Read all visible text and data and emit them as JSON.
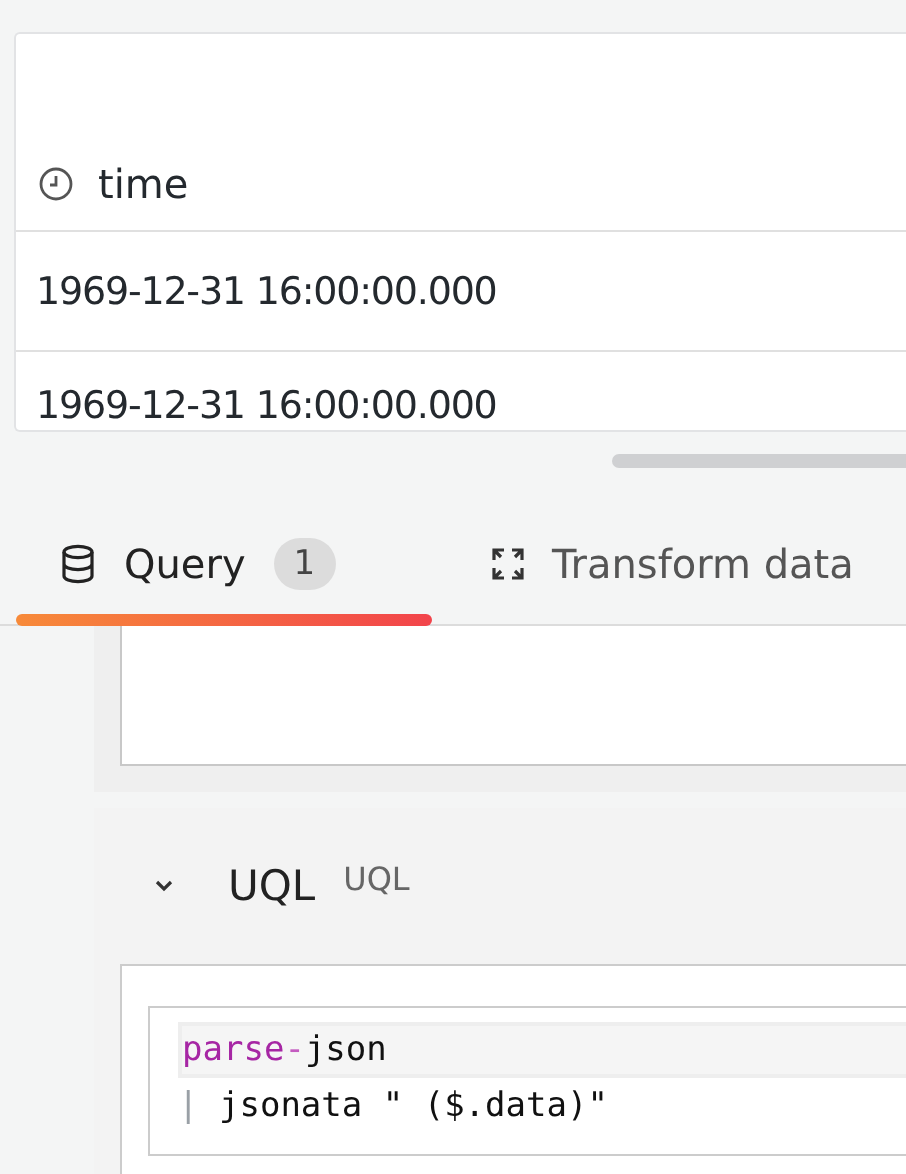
{
  "table": {
    "columns": [
      {
        "label": "time",
        "kind": "time"
      }
    ],
    "rows": [
      {
        "cells": [
          "1969-12-31 16:00:00.000"
        ]
      },
      {
        "cells": [
          "1969-12-31 16:00:00.000"
        ]
      }
    ]
  },
  "tabs": [
    {
      "label": "Query",
      "count": "1",
      "kind": "query",
      "selected": true
    },
    {
      "label": "Transform data",
      "kind": "transform",
      "selected": false
    }
  ],
  "query": {
    "title": "UQL",
    "subtitle": "UQL",
    "expanded": true,
    "code": [
      {
        "tokens": [
          {
            "text": "parse",
            "kind": "keyword"
          },
          {
            "text": "-",
            "kind": "operator"
          },
          {
            "text": "json",
            "kind": "plain"
          }
        ],
        "active": true
      },
      {
        "tokens": [
          {
            "text": "|",
            "kind": "pipe"
          },
          {
            "text": " jsonata \" ($.data)\"",
            "kind": "plain"
          }
        ],
        "active": false
      }
    ]
  }
}
